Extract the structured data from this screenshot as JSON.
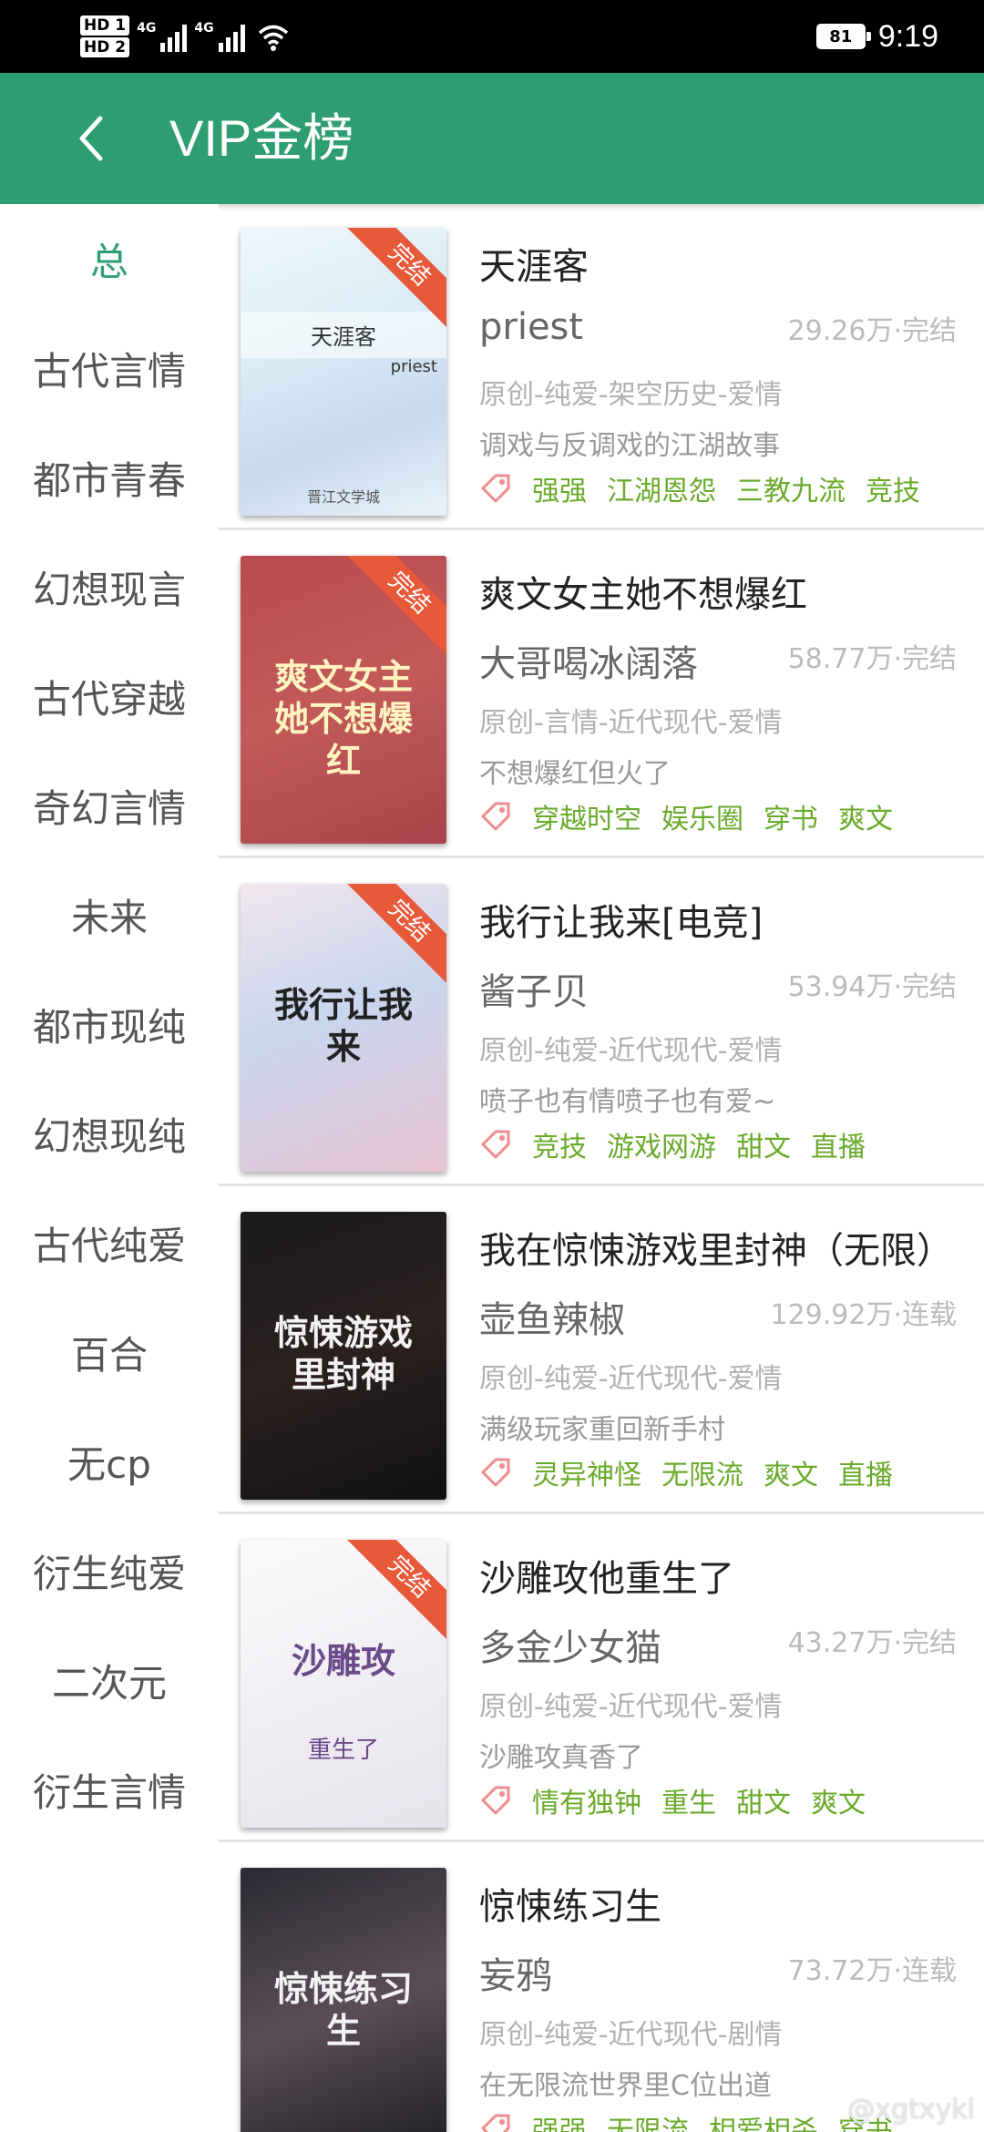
{
  "status_bar": {
    "hd1": "HD 1",
    "hd2": "HD 2",
    "net1": "4G",
    "net2": "4G",
    "battery": "81",
    "time": "9:19"
  },
  "app_bar": {
    "title": "VIP金榜"
  },
  "sidebar": {
    "items": [
      "总",
      "古代言情",
      "都市青春",
      "幻想现言",
      "古代穿越",
      "奇幻言情",
      "未来",
      "都市现纯",
      "幻想现纯",
      "古代纯爱",
      "百合",
      "无cp",
      "衍生纯爱",
      "二次元",
      "衍生言情"
    ],
    "active_index": 0,
    "active_color": "#2e9e72"
  },
  "books": [
    {
      "title": "天涯客",
      "author": "priest",
      "count": "29.26万·完结",
      "genre": "原创-纯爱-架空历史-爱情",
      "blurb": "调戏与反调戏的江湖故事",
      "tags": [
        "强强",
        "江湖恩怨",
        "三教九流",
        "竞技"
      ],
      "cover_text": "天涯客",
      "cover_sub": "priest",
      "cover_footer": "晋江文学城",
      "ribbon": "完结"
    },
    {
      "title": "爽文女主她不想爆红",
      "author": "大哥喝冰阔落",
      "count": "58.77万·完结",
      "genre": "原创-言情-近代现代-爱情",
      "blurb": "不想爆红但火了",
      "tags": [
        "穿越时空",
        "娱乐圈",
        "穿书",
        "爽文"
      ],
      "cover_text": "爽文女主她不想爆红",
      "ribbon": "完结"
    },
    {
      "title": "我行让我来[电竞]",
      "author": "酱子贝",
      "count": "53.94万·完结",
      "genre": "原创-纯爱-近代现代-爱情",
      "blurb": "喷子也有情喷子也有爱~",
      "tags": [
        "竞技",
        "游戏网游",
        "甜文",
        "直播"
      ],
      "cover_text": "我行让我来",
      "ribbon": "完结"
    },
    {
      "title": "我在惊悚游戏里封神（无限）",
      "author": "壶鱼辣椒",
      "count": "129.92万·连载",
      "genre": "原创-纯爱-近代现代-爱情",
      "blurb": "满级玩家重回新手村",
      "tags": [
        "灵异神怪",
        "无限流",
        "爽文",
        "直播"
      ],
      "cover_text": "惊悚游戏里封神"
    },
    {
      "title": "沙雕攻他重生了",
      "author": "多金少女猫",
      "count": "43.27万·完结",
      "genre": "原创-纯爱-近代现代-爱情",
      "blurb": "沙雕攻真香了",
      "tags": [
        "情有独钟",
        "重生",
        "甜文",
        "爽文"
      ],
      "cover_text": "沙雕攻",
      "cover_sub": "重生了",
      "ribbon": "完结"
    },
    {
      "title": "惊悚练习生",
      "author": "妄鸦",
      "count": "73.72万·连载",
      "genre": "原创-纯爱-近代现代-剧情",
      "blurb": "在无限流世界里C位出道",
      "tags": [
        "强强",
        "无限流",
        "相爱相杀",
        "穿书"
      ],
      "cover_text": "惊悚练习生"
    }
  ],
  "watermark": "@xgtxykl",
  "colors": {
    "primary": "#2e9e72",
    "tag": "#6aaa2a",
    "ribbon": "#e8593a"
  }
}
